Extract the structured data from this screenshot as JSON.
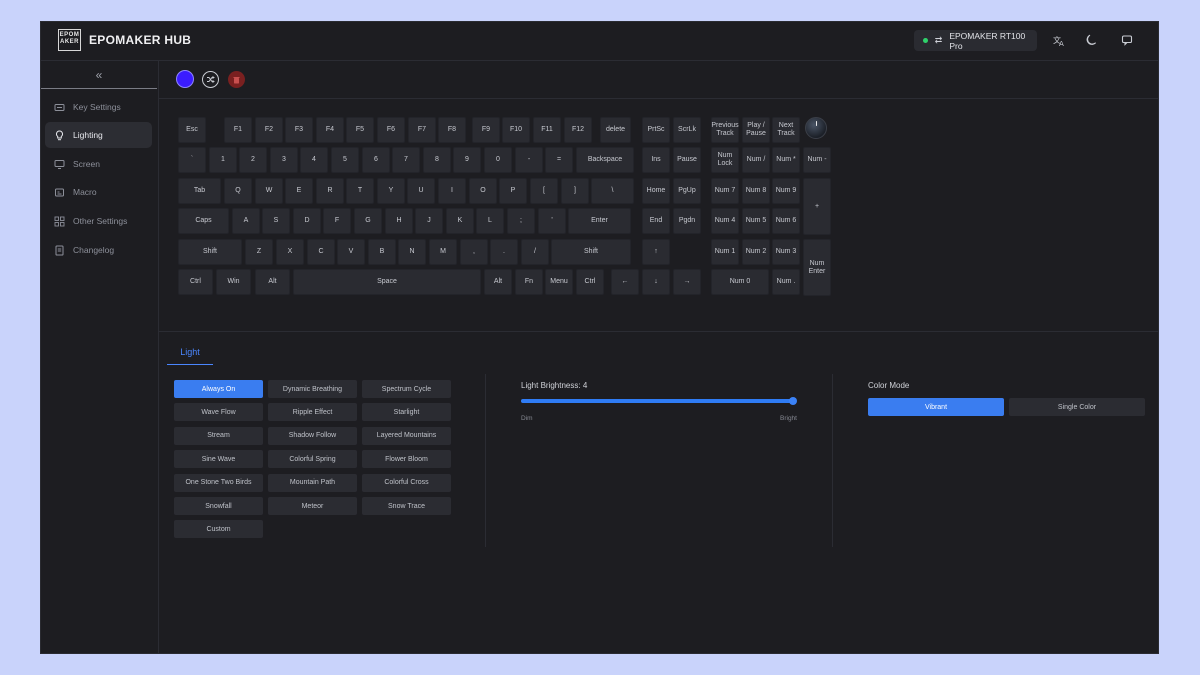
{
  "app": {
    "logo_text": "EPOM AKER",
    "title": "EPOMAKER HUB",
    "device_name": "EPOMAKER RT100 Pro",
    "colors": {
      "accent": "#3a7df0",
      "device_status": "#2fd16b",
      "selected_color": "#3b1cff",
      "reset_button": "#7a2020"
    }
  },
  "sidebar": {
    "collapse_icon": "double-chevron-left-icon",
    "items": [
      {
        "label": "Key Settings",
        "icon": "key-settings-icon"
      },
      {
        "label": "Lighting",
        "icon": "lightbulb-icon"
      },
      {
        "label": "Screen",
        "icon": "monitor-icon"
      },
      {
        "label": "Macro",
        "icon": "macro-icon"
      },
      {
        "label": "Other Settings",
        "icon": "grid-icon"
      },
      {
        "label": "Changelog",
        "icon": "document-icon"
      }
    ]
  },
  "keyboard": {
    "rows": [
      [
        "Esc",
        "F1",
        "F2",
        "F3",
        "F4",
        "F5",
        "F6",
        "F7",
        "F8",
        "F9",
        "F10",
        "F11",
        "F12",
        "delete",
        "PrtSc",
        "ScrLk",
        "Previous Track",
        "Play / Pause",
        "Next Track"
      ],
      [
        "`",
        "1",
        "2",
        "3",
        "4",
        "5",
        "6",
        "7",
        "8",
        "9",
        "0",
        "-",
        "=",
        "Backspace",
        "Ins",
        "Pause",
        "Num Lock",
        "Num /",
        "Num *",
        "Num -"
      ],
      [
        "Tab",
        "Q",
        "W",
        "E",
        "R",
        "T",
        "Y",
        "U",
        "I",
        "O",
        "P",
        "[",
        "]",
        "\\",
        "Home",
        "PgUp",
        "Num 7",
        "Num 8",
        "Num 9",
        "+"
      ],
      [
        "Caps",
        "A",
        "S",
        "D",
        "F",
        "G",
        "H",
        "J",
        "K",
        "L",
        ";",
        "'",
        "Enter",
        "End",
        "Pgdn",
        "Num 4",
        "Num 5",
        "Num 6"
      ],
      [
        "Shift",
        "Z",
        "X",
        "C",
        "V",
        "B",
        "N",
        "M",
        ",",
        ".",
        "/",
        "Shift",
        "↑",
        "Num 1",
        "Num 2",
        "Num 3",
        "Num Enter"
      ],
      [
        "Ctrl",
        "Win",
        "Alt",
        "Space",
        "Alt",
        "Fn",
        "Menu",
        "Ctrl",
        "←",
        "↓",
        "→",
        "Num 0",
        "Num ."
      ]
    ]
  },
  "tabs": [
    {
      "label": "Light"
    }
  ],
  "effects": [
    "Always On",
    "Dynamic Breathing",
    "Spectrum Cycle",
    "Wave Flow",
    "Ripple Effect",
    "Starlight",
    "Stream",
    "Shadow Follow",
    "Layered Mountains",
    "Sine Wave",
    "Colorful Spring",
    "Flower Bloom",
    "One Stone Two Birds",
    "Mountain Path",
    "Colorful Cross",
    "Snowfall",
    "Meteor",
    "Snow Trace",
    "Custom"
  ],
  "active_effect": "Always On",
  "brightness": {
    "label": "Light Brightness: 4",
    "value": 4,
    "max": 4,
    "min_label": "Dim",
    "max_label": "Bright"
  },
  "color_mode": {
    "label": "Color Mode",
    "options": [
      "Vibrant",
      "Single Color"
    ],
    "selected": "Vibrant"
  }
}
